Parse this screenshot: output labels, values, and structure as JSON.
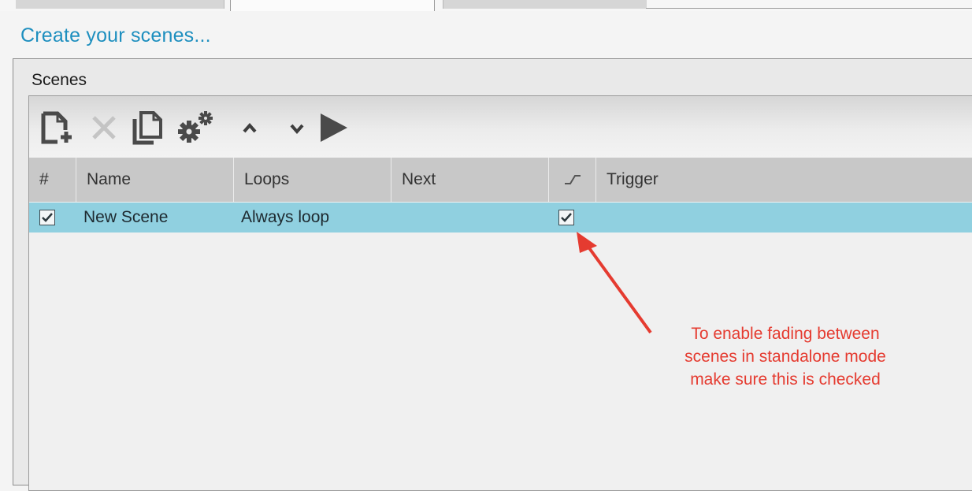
{
  "page": {
    "title": "Create your scenes..."
  },
  "panel": {
    "title": "Scenes"
  },
  "toolbar": {
    "buttons": [
      {
        "icon": "new-document-icon"
      },
      {
        "icon": "delete-x-icon"
      },
      {
        "icon": "duplicate-icon"
      },
      {
        "icon": "gears-icon"
      },
      {
        "icon": "chevron-up-icon"
      },
      {
        "icon": "chevron-down-icon"
      },
      {
        "icon": "play-icon"
      }
    ]
  },
  "table": {
    "columns": [
      "#",
      "Name",
      "Loops",
      "Next",
      "",
      "Trigger"
    ],
    "fade_column_icon": "fade-ramp-icon",
    "rows": [
      {
        "enabled": true,
        "name": "New Scene",
        "loops": "Always loop",
        "next": "",
        "fade": true,
        "trigger": ""
      }
    ]
  },
  "annotation": {
    "line1": "To enable fading between",
    "line2": "scenes in standalone mode",
    "line3": "make sure this is checked",
    "color": "#e53b30"
  },
  "colors": {
    "accent": "#1e8fbf",
    "row_selected": "#90d0e0",
    "annotation": "#e53b30"
  }
}
